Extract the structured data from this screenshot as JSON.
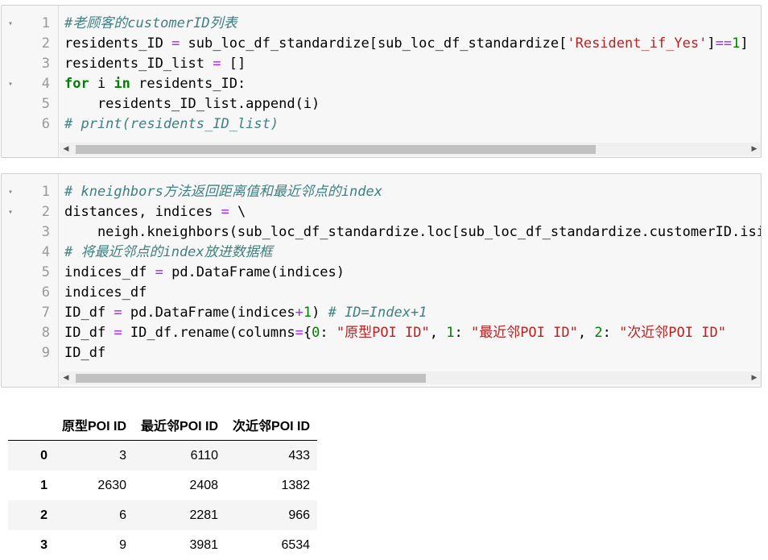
{
  "cell1": {
    "lines": [
      {
        "num": "1",
        "fold": "▾",
        "tokens": [
          {
            "t": "#老顾客的customerID列表",
            "c": "cm"
          }
        ]
      },
      {
        "num": "2",
        "fold": "",
        "tokens": [
          {
            "t": "residents_ID ",
            "c": ""
          },
          {
            "t": "=",
            "c": "op"
          },
          {
            "t": " sub_loc_df_standardize[sub_loc_df_standardize[",
            "c": ""
          },
          {
            "t": "'Resident_if_Yes'",
            "c": "str"
          },
          {
            "t": "]",
            "c": ""
          },
          {
            "t": "==",
            "c": "op"
          },
          {
            "t": "1",
            "c": "num"
          },
          {
            "t": "]",
            "c": ""
          }
        ]
      },
      {
        "num": "3",
        "fold": "",
        "tokens": [
          {
            "t": "residents_ID_list ",
            "c": ""
          },
          {
            "t": "=",
            "c": "op"
          },
          {
            "t": " []",
            "c": ""
          }
        ]
      },
      {
        "num": "4",
        "fold": "▾",
        "tokens": [
          {
            "t": "for",
            "c": "kw"
          },
          {
            "t": " i ",
            "c": ""
          },
          {
            "t": "in",
            "c": "kw"
          },
          {
            "t": " residents_ID:",
            "c": ""
          }
        ]
      },
      {
        "num": "5",
        "fold": "",
        "tokens": [
          {
            "t": "    residents_ID_list.append(i)",
            "c": ""
          }
        ]
      },
      {
        "num": "6",
        "fold": "",
        "tokens": [
          {
            "t": "# print(residents_ID_list)",
            "c": "cm"
          }
        ]
      }
    ],
    "scroll_left_arrow": "◀",
    "scroll_right_arrow": "▶"
  },
  "cell2": {
    "lines": [
      {
        "num": "1",
        "fold": "▾",
        "tokens": [
          {
            "t": "# kneighbors方法返回距离值和最近邻点的index",
            "c": "cm"
          }
        ]
      },
      {
        "num": "2",
        "fold": "▾",
        "tokens": [
          {
            "t": "distances, indices ",
            "c": ""
          },
          {
            "t": "=",
            "c": "op"
          },
          {
            "t": " \\",
            "c": ""
          }
        ]
      },
      {
        "num": "3",
        "fold": "",
        "tokens": [
          {
            "t": "    neigh.kneighbors(sub_loc_df_standardize.loc[sub_loc_df_standardize.customerID.isin",
            "c": ""
          }
        ]
      },
      {
        "num": "4",
        "fold": "",
        "tokens": [
          {
            "t": "# 将最近邻点的index放进数据框",
            "c": "cm"
          }
        ]
      },
      {
        "num": "5",
        "fold": "",
        "tokens": [
          {
            "t": "indices_df ",
            "c": ""
          },
          {
            "t": "=",
            "c": "op"
          },
          {
            "t": " pd.DataFrame(indices)",
            "c": ""
          }
        ]
      },
      {
        "num": "6",
        "fold": "",
        "tokens": [
          {
            "t": "indices_df",
            "c": ""
          }
        ]
      },
      {
        "num": "7",
        "fold": "",
        "tokens": [
          {
            "t": "ID_df ",
            "c": ""
          },
          {
            "t": "=",
            "c": "op"
          },
          {
            "t": " pd.DataFrame(indices",
            "c": ""
          },
          {
            "t": "+",
            "c": "op"
          },
          {
            "t": "1",
            "c": "num"
          },
          {
            "t": ") ",
            "c": ""
          },
          {
            "t": "# ID=Index+1",
            "c": "cm"
          }
        ]
      },
      {
        "num": "8",
        "fold": "",
        "tokens": [
          {
            "t": "ID_df ",
            "c": ""
          },
          {
            "t": "=",
            "c": "op"
          },
          {
            "t": " ID_df.rename(columns",
            "c": ""
          },
          {
            "t": "=",
            "c": "op"
          },
          {
            "t": "{",
            "c": ""
          },
          {
            "t": "0",
            "c": "num"
          },
          {
            "t": ": ",
            "c": ""
          },
          {
            "t": "\"原型POI ID\"",
            "c": "str"
          },
          {
            "t": ", ",
            "c": ""
          },
          {
            "t": "1",
            "c": "num"
          },
          {
            "t": ": ",
            "c": ""
          },
          {
            "t": "\"最近邻POI ID\"",
            "c": "str"
          },
          {
            "t": ", ",
            "c": ""
          },
          {
            "t": "2",
            "c": "num"
          },
          {
            "t": ": ",
            "c": ""
          },
          {
            "t": "\"次近邻POI ID\"",
            "c": "str"
          }
        ]
      },
      {
        "num": "9",
        "fold": "",
        "tokens": [
          {
            "t": "ID_df",
            "c": ""
          }
        ]
      }
    ],
    "scroll_left_arrow": "◀",
    "scroll_right_arrow": "▶"
  },
  "output_table": {
    "columns": [
      "",
      "原型POI ID",
      "最近邻POI ID",
      "次近邻POI ID"
    ],
    "rows": [
      {
        "index": "0",
        "values": [
          "3",
          "6110",
          "433"
        ]
      },
      {
        "index": "1",
        "values": [
          "2630",
          "2408",
          "1382"
        ]
      },
      {
        "index": "2",
        "values": [
          "6",
          "2281",
          "966"
        ]
      },
      {
        "index": "3",
        "values": [
          "9",
          "3981",
          "6534"
        ]
      }
    ]
  }
}
